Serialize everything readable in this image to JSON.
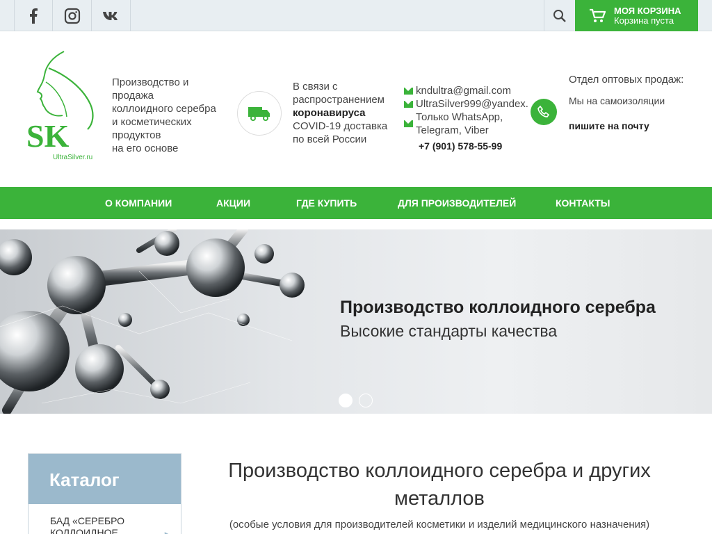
{
  "topbar": {
    "social": [
      "facebook-icon",
      "instagram-icon",
      "vk-icon"
    ],
    "cart": {
      "title": "МОЯ КОРЗИНА",
      "status": "Корзина пуста"
    }
  },
  "logo": {
    "letters": "SK",
    "site": "UltraSilver.ru"
  },
  "header": {
    "about_lines": [
      "Производство и",
      "продажа",
      "коллоидного серебра",
      "и косметических",
      "продуктов",
      "на его основе"
    ],
    "covid_pre": "В связи с распространением",
    "covid_bold": "коронавируса",
    "covid_post": "COVID-19 доставка по всей России",
    "emails": [
      "kndultra@gmail.com",
      "UltraSilver999@yandex.",
      "Только WhatsApp, Telegram, Viber"
    ],
    "phone": "+7 (901) 578-55-99",
    "wholesale_title": "Отдел оптовых продаж:",
    "wholesale_iso": "Мы на самоизоляции",
    "wholesale_mail": "пишите на почту"
  },
  "nav": [
    {
      "label": "О КОМПАНИИ"
    },
    {
      "label": "АКЦИИ"
    },
    {
      "label": "ГДЕ КУПИТЬ"
    },
    {
      "label": "ДЛЯ ПРОИЗВОДИТЕЛЕЙ"
    },
    {
      "label": "КОНТАКТЫ"
    }
  ],
  "banner": {
    "title": "Производство коллоидного серебра",
    "subtitle": "Высокие стандарты качества",
    "slides": 2,
    "active_slide": 1
  },
  "catalog": {
    "title": "Каталог",
    "items": [
      {
        "label": "БАД «СЕРЕБРО КОЛЛОИДНОЕ"
      }
    ]
  },
  "main": {
    "title": "Производство коллоидного серебра и других металлов",
    "subtitle": "(особые условия для производителей косметики и изделий медицинского назначения)"
  },
  "colors": {
    "brand_green": "#3bb33a",
    "catalog_blue": "#9bb9cc",
    "topbar_bg": "#e8eef2"
  }
}
